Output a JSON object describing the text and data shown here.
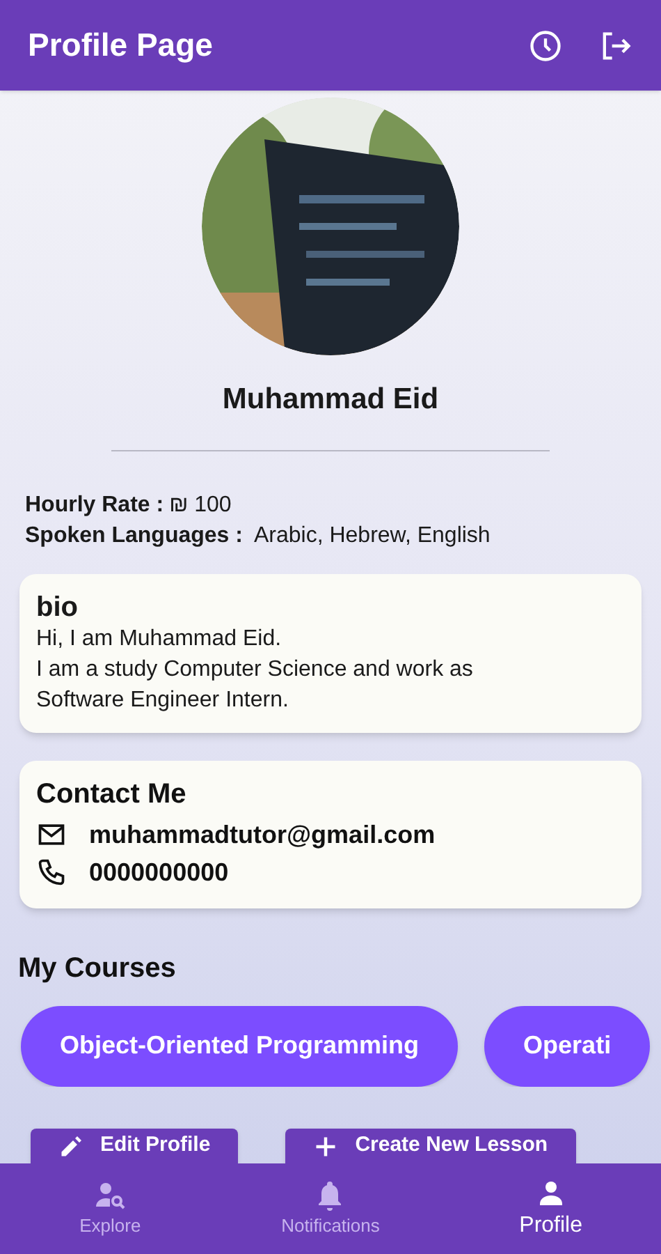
{
  "app_bar": {
    "title": "Profile Page"
  },
  "profile": {
    "name": "Muhammad Eid",
    "hourly_rate_label": "Hourly Rate :",
    "hourly_rate": "₪ 100",
    "languages_label": "Spoken Languages :",
    "languages": "Arabic, Hebrew, English"
  },
  "bio": {
    "title": "bio",
    "lines": [
      "Hi, I am Muhammad Eid.",
      "I am a study Computer Science and work as Software Engineer Intern."
    ]
  },
  "contact": {
    "title": "Contact Me",
    "items": [
      {
        "kind": "email",
        "text": "muhammadtutor@gmail.com"
      },
      {
        "kind": "phone",
        "text": "0000000000"
      }
    ]
  },
  "courses": {
    "title": "My Courses",
    "items": [
      "Object-Oriented Programming",
      "Operati"
    ]
  },
  "actions": [
    {
      "kind": "edit",
      "label": "Edit Profile"
    },
    {
      "kind": "add",
      "label": "Create New Lesson"
    }
  ],
  "bottom_nav": [
    {
      "kind": "explore",
      "label": "Explore",
      "selected": false
    },
    {
      "kind": "notifications",
      "label": "Notifications",
      "selected": false
    },
    {
      "kind": "profile",
      "label": "Profile",
      "selected": true
    }
  ]
}
